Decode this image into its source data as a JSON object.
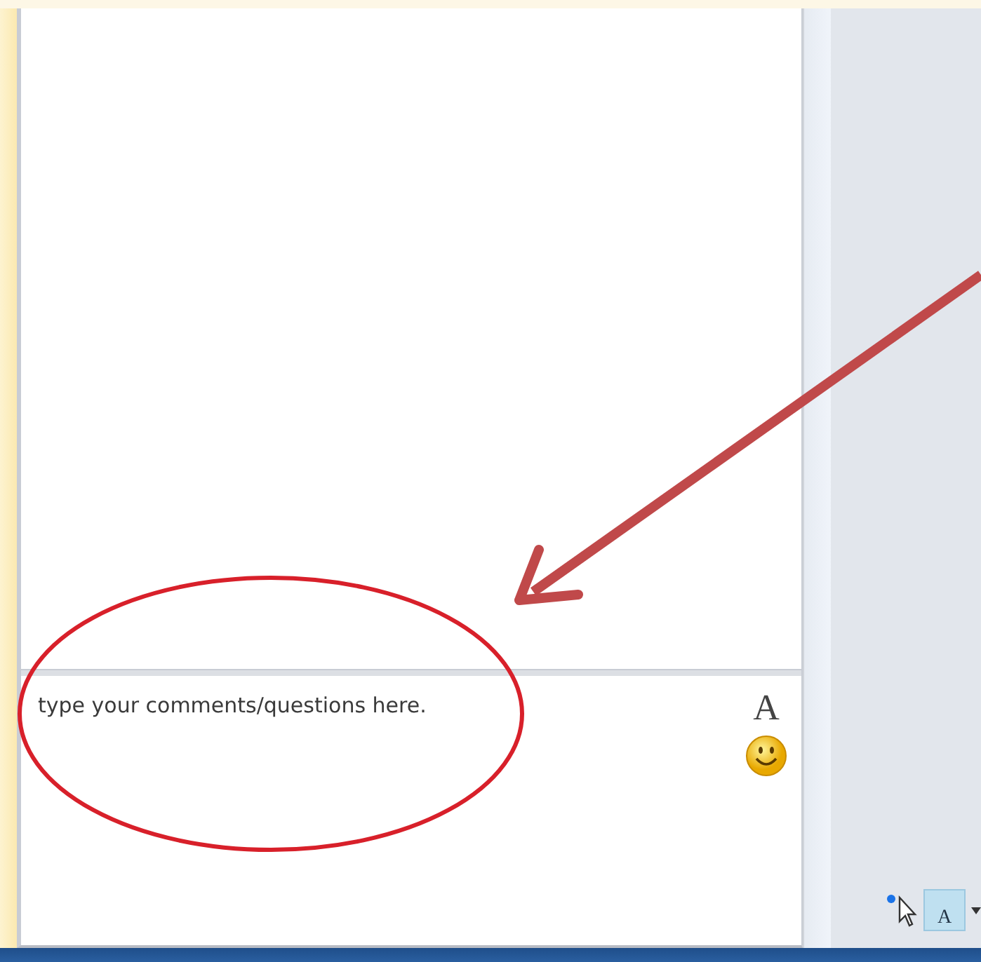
{
  "chat": {
    "input": {
      "placeholder": "type your comments/questions here."
    },
    "font_button": "A"
  },
  "toolbar": {
    "text_tool_label": "A"
  },
  "annotations": [
    {
      "kind": "ellipse"
    },
    {
      "kind": "arrow"
    }
  ]
}
